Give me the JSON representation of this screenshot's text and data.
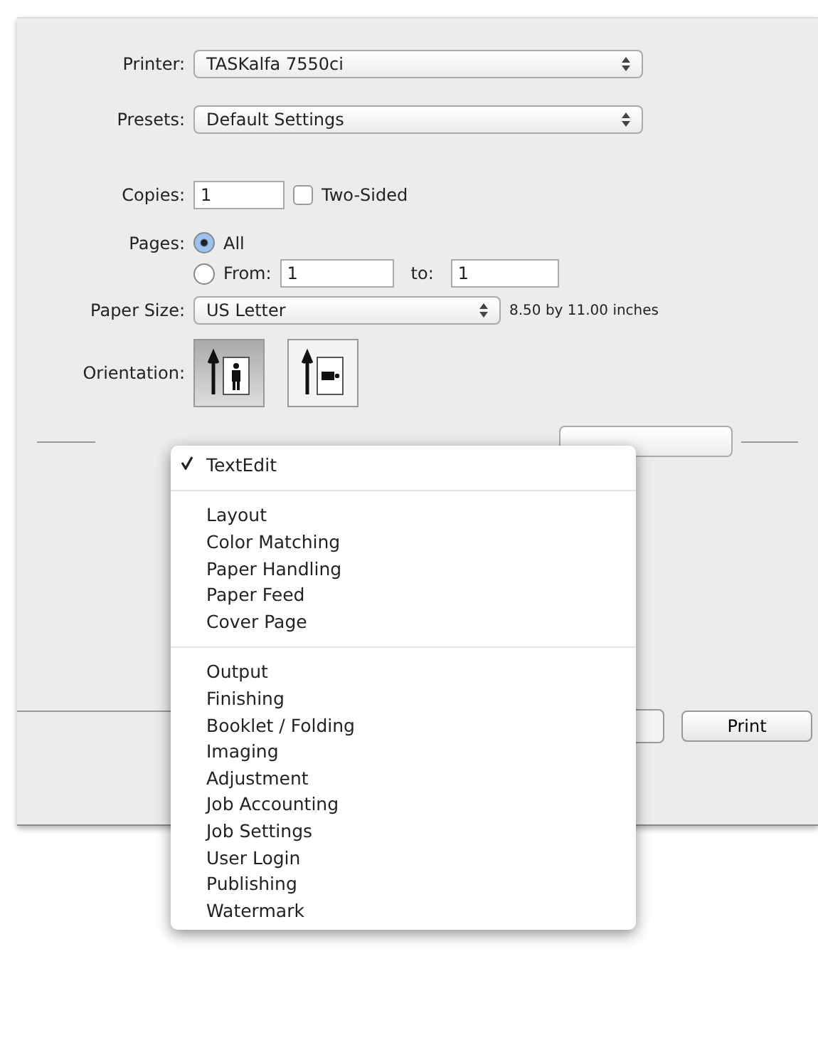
{
  "form": {
    "printer": {
      "label": "Printer:",
      "value": "TASKalfa 7550ci"
    },
    "presets": {
      "label": "Presets:",
      "value": "Default Settings"
    },
    "copies": {
      "label": "Copies:",
      "value": "1",
      "two_sided": {
        "label": "Two-Sided",
        "checked": false
      }
    },
    "pages": {
      "label": "Pages:",
      "options": [
        {
          "label": "All",
          "selected": true
        },
        {
          "label": "From:",
          "selected": false
        }
      ],
      "from": "1",
      "to_label": "to:",
      "to": "1"
    },
    "paper_size": {
      "label": "Paper Size:",
      "value": "US Letter",
      "dimensions": "8.50 by 11.00 inches"
    },
    "orientation": {
      "label": "Orientation:",
      "options": [
        {
          "kind": "portrait",
          "selected": true
        },
        {
          "kind": "landscape",
          "selected": false
        }
      ]
    }
  },
  "buttons": [
    {
      "label": "Print"
    }
  ],
  "menu": {
    "groups": [
      [
        {
          "label": "TextEdit",
          "checked": true
        }
      ],
      [
        {
          "label": "Layout",
          "checked": false
        },
        {
          "label": "Color Matching",
          "checked": false
        },
        {
          "label": "Paper Handling",
          "checked": false
        },
        {
          "label": "Paper Feed",
          "checked": false
        },
        {
          "label": "Cover Page",
          "checked": false
        }
      ],
      [
        {
          "label": "Output",
          "checked": false
        },
        {
          "label": "Finishing",
          "checked": false
        },
        {
          "label": "Booklet / Folding",
          "checked": false
        },
        {
          "label": "Imaging",
          "checked": false
        },
        {
          "label": "Adjustment",
          "checked": false
        },
        {
          "label": "Job Accounting",
          "checked": false
        },
        {
          "label": "Job Settings",
          "checked": false
        },
        {
          "label": "User Login",
          "checked": false
        },
        {
          "label": "Publishing",
          "checked": false
        },
        {
          "label": "Watermark",
          "checked": false
        }
      ]
    ]
  }
}
